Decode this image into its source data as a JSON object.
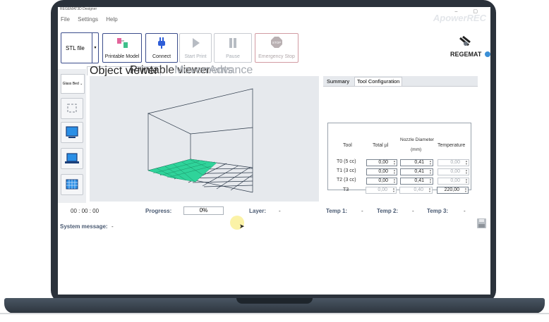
{
  "window": {
    "title": "REGEMAT3D Designer",
    "watermark": "ApowerREC",
    "controls": "– ▢"
  },
  "menu": [
    "File",
    "Settings",
    "Help"
  ],
  "toolbar": {
    "stl_label": "STL file",
    "printable_model": "Printable Model",
    "connect": "Connect",
    "start_print": "Start Print",
    "pause": "Pause",
    "emergency_stop": "Emergency Stop",
    "stop_sign": "STOP"
  },
  "brand": {
    "logo": "REGEMAT"
  },
  "sidebar": {
    "bed_select": "Glass Bed"
  },
  "viewer_tabs": [
    {
      "label": "Object viewer",
      "state": "active"
    },
    {
      "label": "Printable viewer",
      "state": "enabled"
    },
    {
      "label": "Movements",
      "state": "disabled"
    },
    {
      "label": "Advance",
      "state": "disabled"
    }
  ],
  "right_tabs": [
    {
      "label": "Summary",
      "state": "enabled"
    },
    {
      "label": "Tool Configuration",
      "state": "active"
    }
  ],
  "tool_table": {
    "headers": {
      "tool": "Tool",
      "total": "Total µl",
      "nozzle": "Nozzle Diameter",
      "nozzle_unit": "(mm)",
      "temperature": "Temperature"
    },
    "rows": [
      {
        "tool": "T0 (5 cc)",
        "total": "0,00",
        "nozzle": "0,41",
        "temp": "0,00"
      },
      {
        "tool": "T1 (3 cc)",
        "total": "0,00",
        "nozzle": "0,41",
        "temp": "0,00"
      },
      {
        "tool": "T2 (3 cc)",
        "total": "0,00",
        "nozzle": "0,41",
        "temp": "0,00"
      },
      {
        "tool": "T3",
        "total": "0,00",
        "nozzle": "0,40",
        "temp": "220,00"
      }
    ]
  },
  "status": {
    "time": "00 : 00 : 00",
    "progress_label": "Progress:",
    "progress_value": "0%",
    "layer_label": "Layer:",
    "layer_value": "-",
    "temp1_label": "Temp 1:",
    "temp1_value": "-",
    "temp2_label": "Temp 2:",
    "temp2_value": "-",
    "temp3_label": "Temp 3:",
    "temp3_value": "-",
    "system_message_label": "System message:",
    "system_message_value": "-"
  },
  "colors": {
    "accent": "#3b4d8c",
    "bed_fill": "#2fd39a",
    "bezel": "#2b323b"
  }
}
